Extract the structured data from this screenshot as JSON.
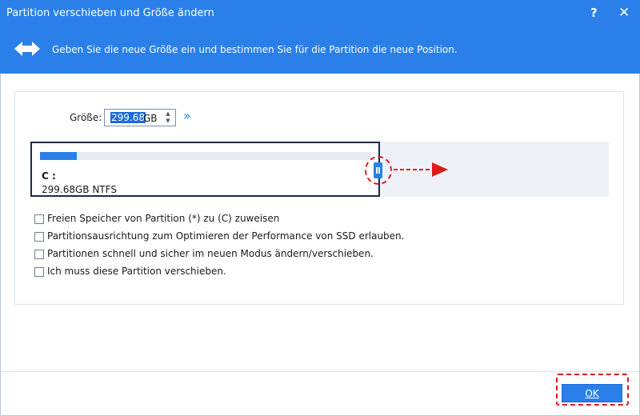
{
  "window": {
    "title": "Partition verschieben und Größe ändern",
    "help_label": "?",
    "close_label": "✕"
  },
  "banner": {
    "text": "Geben Sie die neue Größe ein und bestimmen Sie für die Partition die neue Position.",
    "icon": "resize-arrows-icon"
  },
  "size": {
    "label": "Größe:",
    "value": "299.68",
    "unit": "GB",
    "expand_glyph": "»"
  },
  "partition": {
    "letter": "C :",
    "info": "299.68GB NTFS",
    "used_fraction": 0.11
  },
  "options": [
    {
      "label": "Freien Speicher von Partition (*) zu (C) zuweisen",
      "checked": false
    },
    {
      "label": "Partitionsausrichtung zum Optimieren der Performance von SSD erlauben.",
      "checked": false
    },
    {
      "label": "Partitionen schnell und sicher im neuen Modus ändern/verschieben.",
      "checked": false
    },
    {
      "label": "Ich muss diese Partition verschieben.",
      "checked": false
    }
  ],
  "footer": {
    "ok_label": "OK"
  },
  "colors": {
    "accent": "#2a80e8",
    "highlight": "#e01b1b"
  }
}
